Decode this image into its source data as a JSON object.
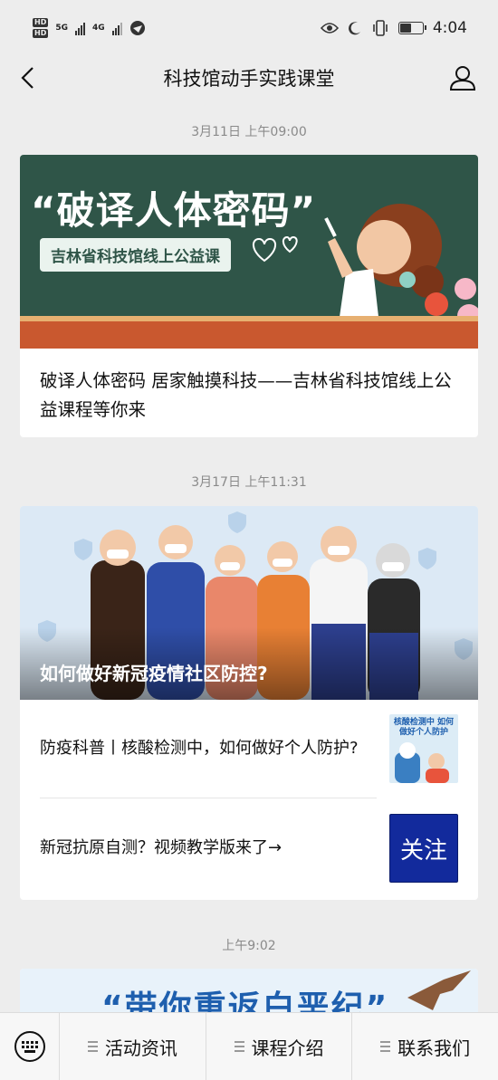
{
  "status_bar": {
    "network_1": "5G",
    "network_2": "4G",
    "time": "4:04",
    "battery_level": 0.45
  },
  "nav": {
    "title": "科技馆动手实践课堂"
  },
  "messages": [
    {
      "time": "3月11日 上午09:00",
      "banner_title": "“破译人体密码”",
      "banner_tag": "吉林省科技馆线上公益课",
      "headline": "破译人体密码 居家触摸科技——吉林省科技馆线上公益课程等你来"
    },
    {
      "time": "3月17日 上午11:31",
      "banner_title": "如何做好新冠疫情社区防控?",
      "items": [
        {
          "text": "防疫科普丨核酸检测中，如何做好个人防护?",
          "thumb_text": "核酸检测中 如何做好个人防护"
        },
        {
          "text": "新冠抗原自测？视频教学版来了→",
          "thumb_text": "关注"
        }
      ]
    },
    {
      "time": "上午9:02",
      "banner_title": "“带你重返白垩纪”"
    }
  ],
  "bottom_bar": {
    "menus": [
      "活动资讯",
      "课程介绍",
      "联系我们"
    ]
  }
}
